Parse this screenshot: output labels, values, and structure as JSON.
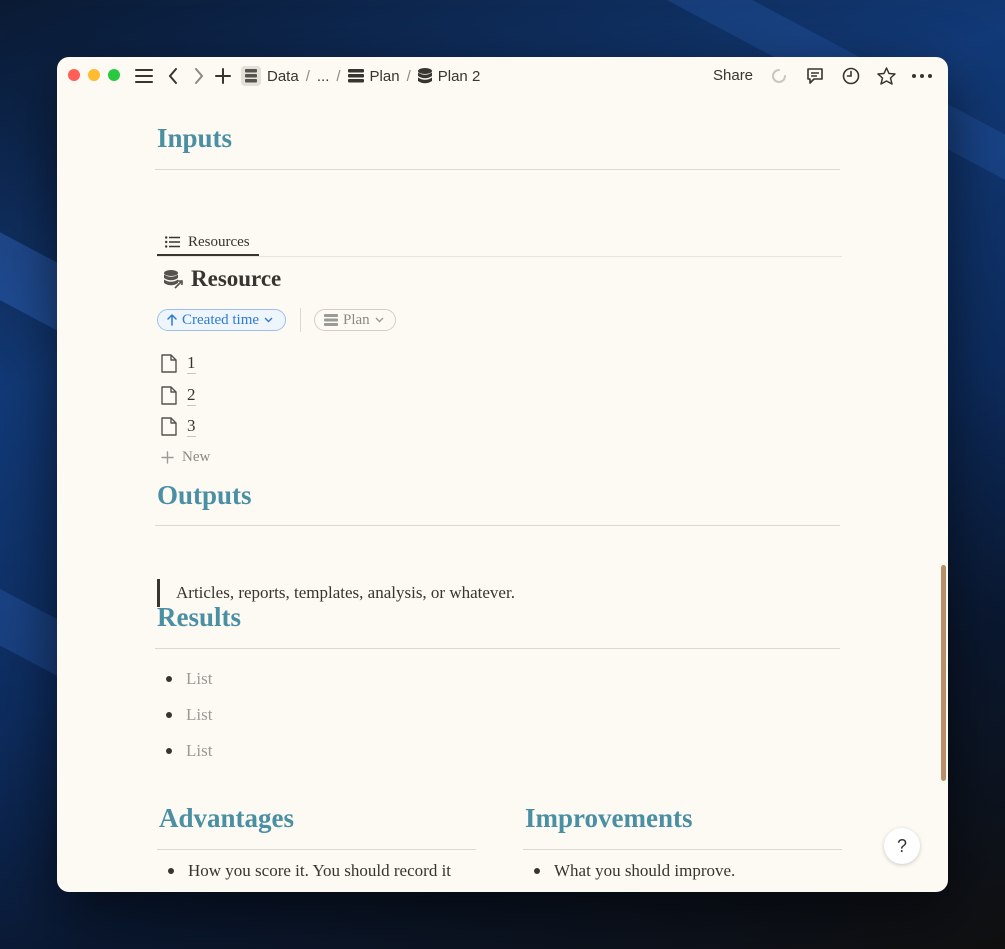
{
  "titlebar": {
    "breadcrumbs": [
      "Data",
      "...",
      "Plan",
      "Plan 2"
    ],
    "separator": "/",
    "share_label": "Share"
  },
  "sections": {
    "inputs": {
      "heading": "Inputs",
      "tab_label": "Resources",
      "database_title": "Resource",
      "sort_chip": "Created time",
      "filter_chip": "Plan",
      "rows": [
        "1",
        "2",
        "3"
      ],
      "new_label": "New"
    },
    "outputs": {
      "heading": "Outputs",
      "quote": "Articles, reports, templates, analysis, or whatever."
    },
    "results": {
      "heading": "Results",
      "items": [
        "List",
        "List",
        "List"
      ]
    },
    "advantages": {
      "heading": "Advantages",
      "items": [
        "How you score it. You should record it"
      ]
    },
    "improvements": {
      "heading": "Improvements",
      "items": [
        "What you should improve."
      ]
    }
  },
  "help_label": "?",
  "colors": {
    "heading": "#4a8fa3",
    "text": "#37352f",
    "placeholder": "#9b9a97",
    "link_blue": "#2e7bd6",
    "background": "#fdfaf3",
    "scrollbar": "#b88f68"
  },
  "icons": {
    "sidebar": "hamburger-icon",
    "back": "chevron-left-icon",
    "forward": "chevron-right-icon",
    "new": "plus-icon",
    "comments": "comment-icon",
    "history": "clock-icon",
    "favorite": "star-icon",
    "more": "ellipsis-icon",
    "page": "document-icon",
    "database": "database-icon",
    "list": "list-icon",
    "loading": "spinner-icon"
  }
}
